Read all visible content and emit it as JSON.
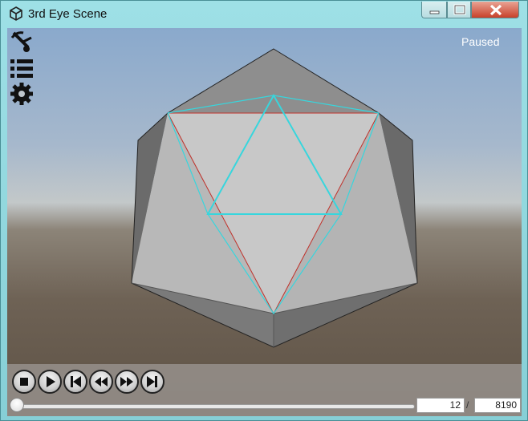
{
  "window": {
    "title": "3rd Eye Scene",
    "controls": [
      "minimize-icon",
      "maximize-icon",
      "close-icon"
    ]
  },
  "viewport": {
    "status": "Paused",
    "overlay_icons": [
      "satellite-dish-icon",
      "list-icon",
      "gear-icon"
    ],
    "scene": "icosahedron"
  },
  "playback": {
    "buttons": [
      "stop-icon",
      "play-icon",
      "skip-to-start-icon",
      "step-back-icon",
      "step-forward-icon",
      "skip-to-end-icon"
    ],
    "current_frame": "12",
    "separator": "/",
    "total_frames": "8190",
    "progress_fraction": 0.0015
  },
  "colors": {
    "wire_cyan": "#37d6dd",
    "wire_red": "#c0312a",
    "titlebar": "#9ee0e6"
  }
}
